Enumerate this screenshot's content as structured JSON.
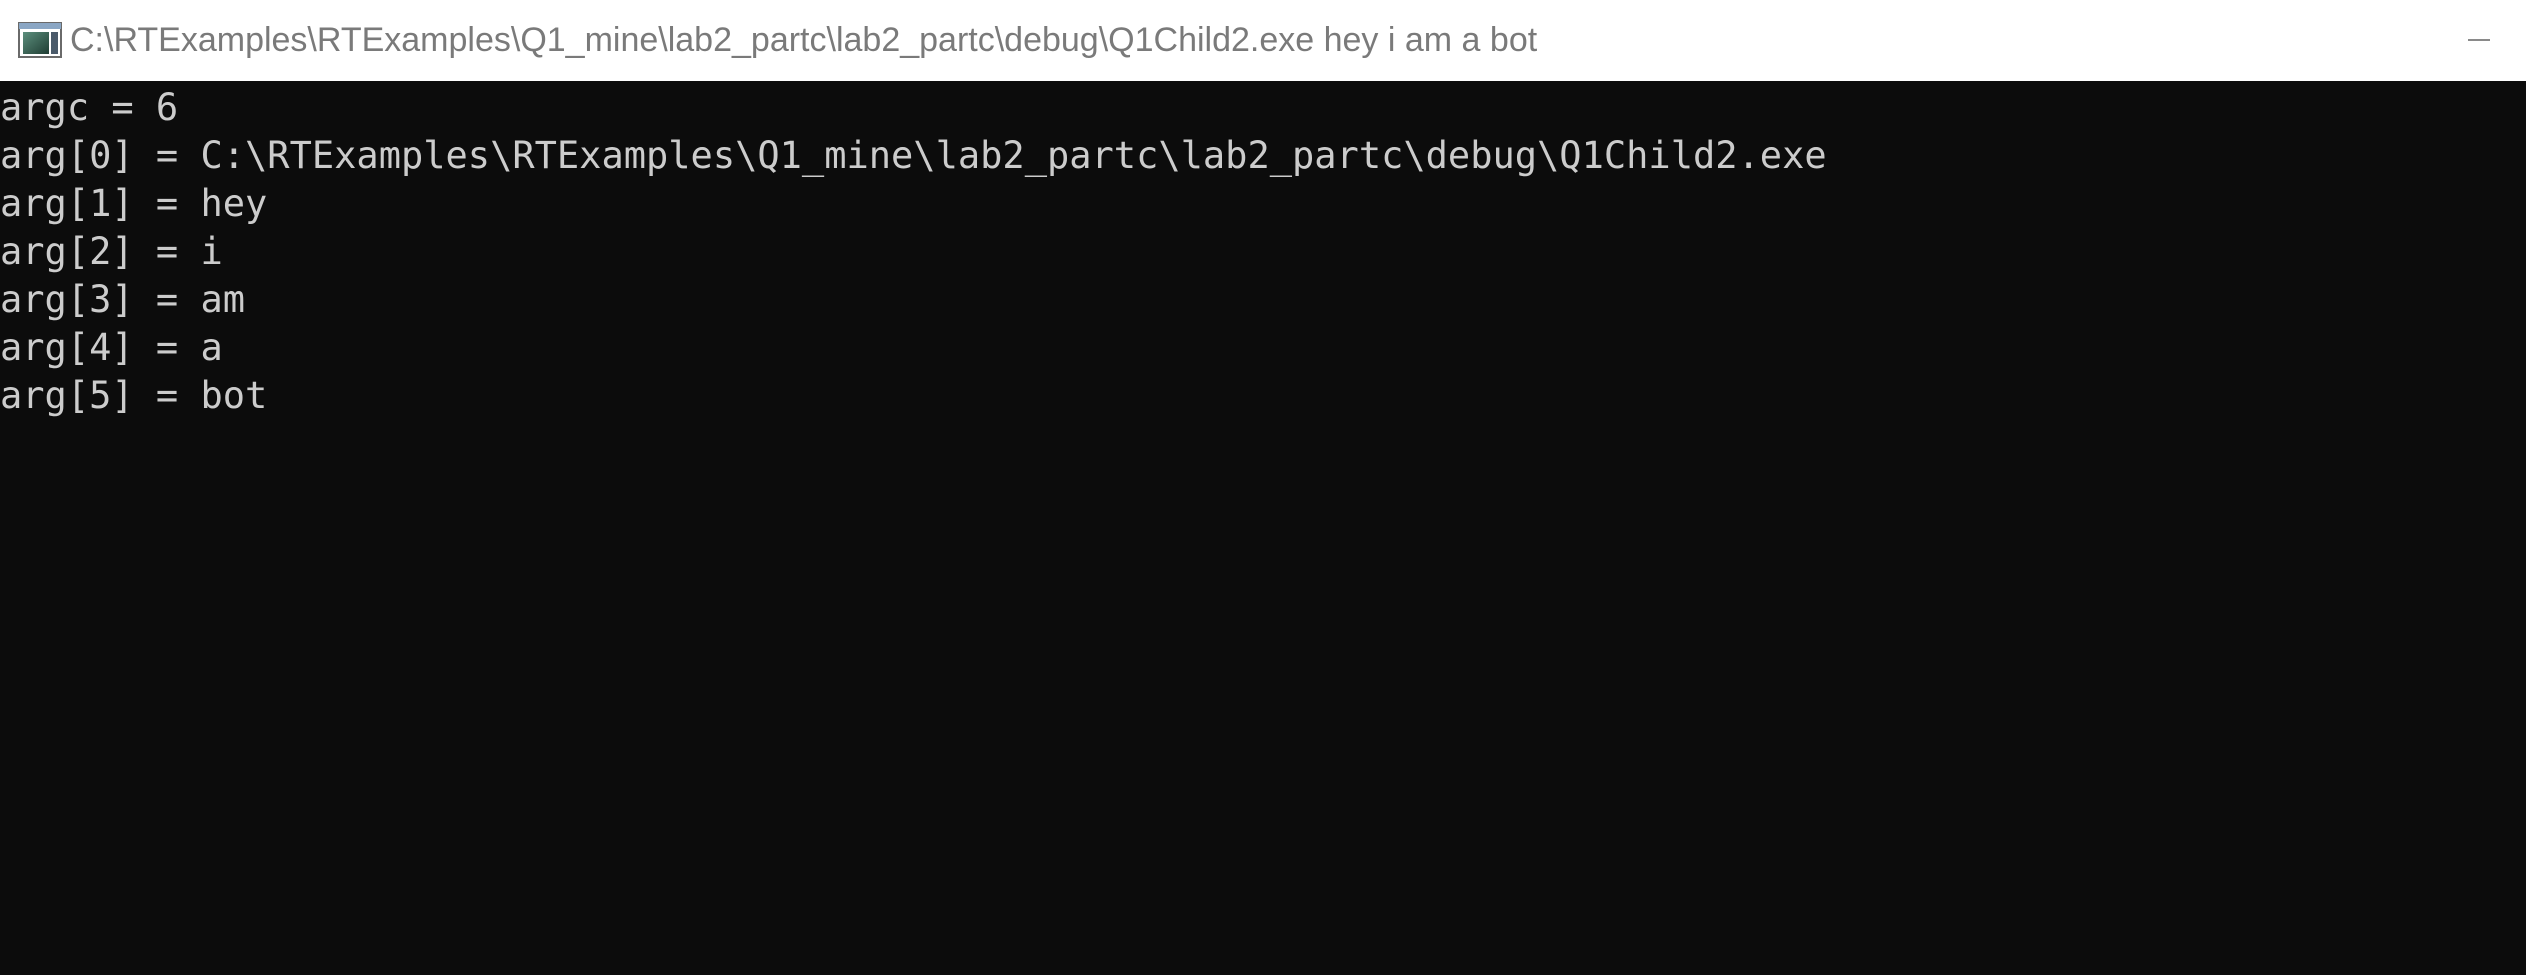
{
  "window": {
    "title": "C:\\RTExamples\\RTExamples\\Q1_mine\\lab2_partc\\lab2_partc\\debug\\Q1Child2.exe hey i am a bot",
    "icon": "console-app-icon",
    "minimize_icon": "minimize-icon"
  },
  "console": {
    "lines": [
      "argc = 6",
      "arg[0] = C:\\RTExamples\\RTExamples\\Q1_mine\\lab2_partc\\lab2_partc\\debug\\Q1Child2.exe",
      "arg[1] = hey",
      "arg[2] = i",
      "arg[3] = am",
      "arg[4] = a",
      "arg[5] = bot"
    ]
  },
  "colors": {
    "console_background": "#0c0c0c",
    "console_text": "#cccccc",
    "titlebar_background": "#ffffff",
    "title_text": "#7a7a7a"
  }
}
